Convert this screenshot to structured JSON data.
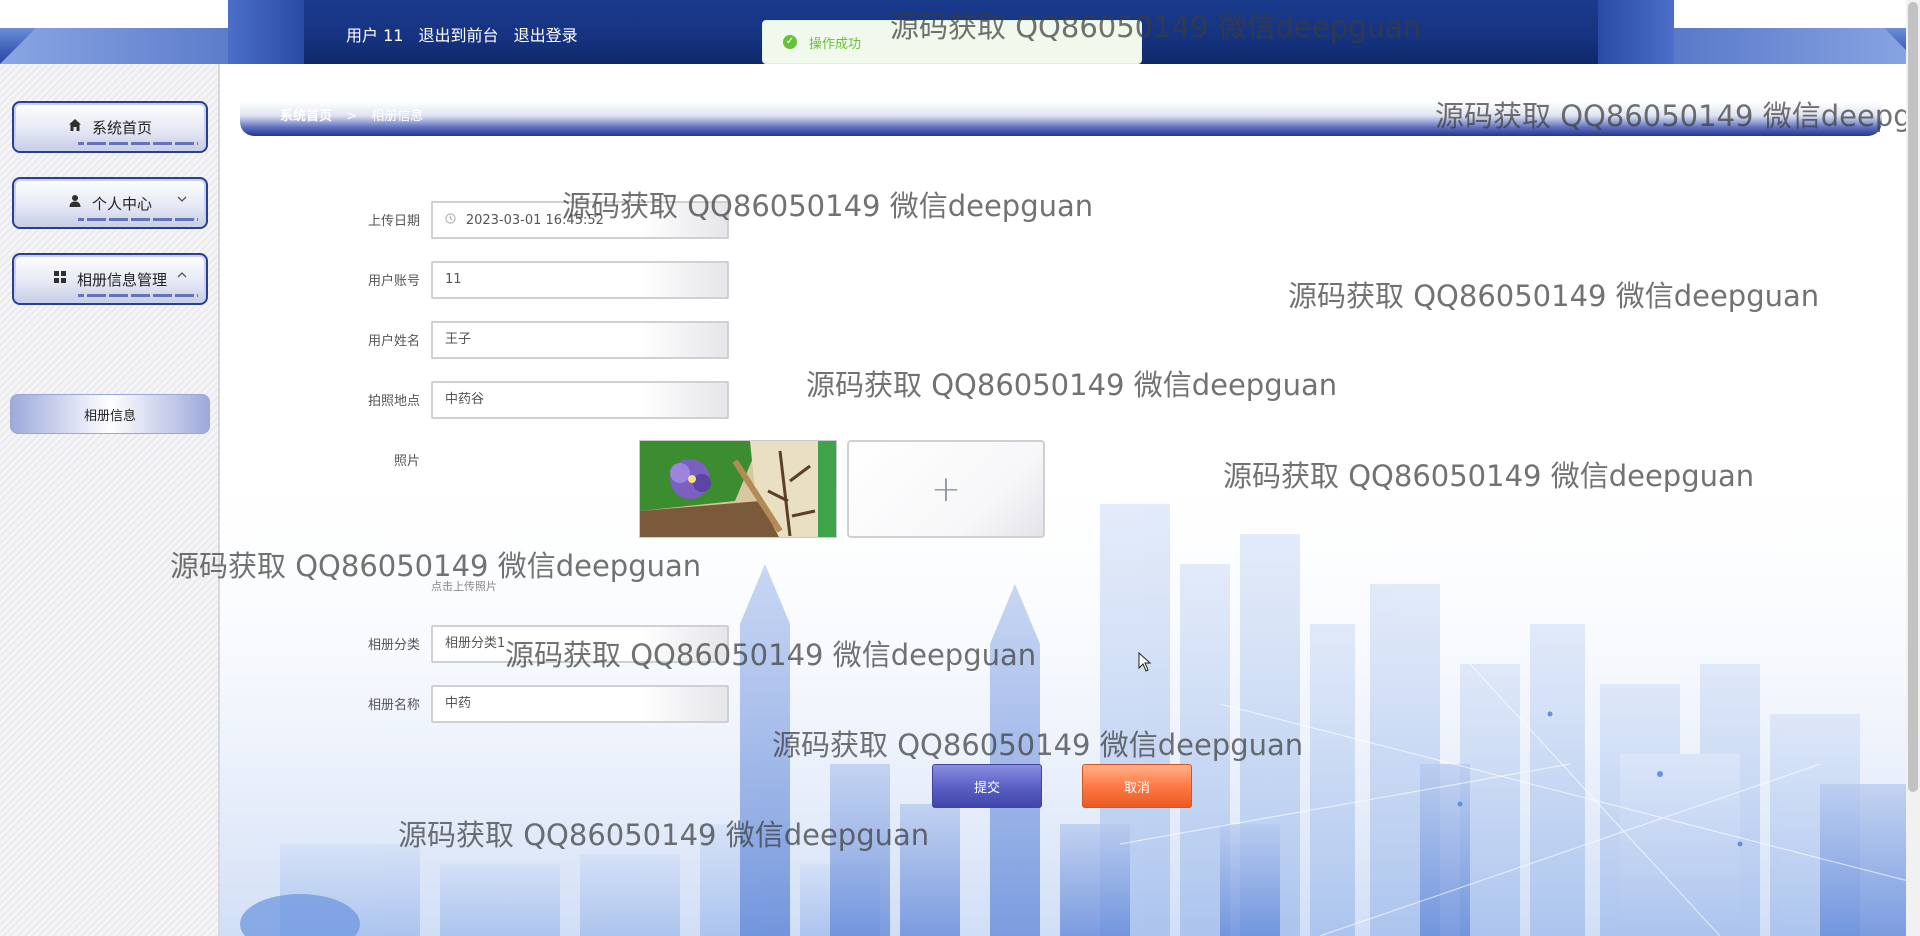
{
  "header": {
    "user_label": "用户 11",
    "back_to_front_label": "退出到前台",
    "logout_label": "退出登录"
  },
  "toast": {
    "message": "操作成功",
    "icon": "check-circle-icon",
    "color": "#67c23a"
  },
  "sidebar": {
    "items": [
      {
        "label": "系统首页",
        "icon": "home-icon"
      },
      {
        "label": "个人中心",
        "icon": "user-icon",
        "chevron": "chevron-down-icon"
      },
      {
        "label": "相册信息管理",
        "icon": "grid-icon",
        "chevron": "chevron-up-icon"
      }
    ],
    "subitems": [
      {
        "label": "相册信息"
      }
    ]
  },
  "breadcrumb": {
    "home": "系统首页",
    "separator": ">",
    "current": "相册信息"
  },
  "form": {
    "upload_date": {
      "label": "上传日期",
      "value": "2023-03-01 16:45:52"
    },
    "account": {
      "label": "用户账号",
      "value": "11"
    },
    "name": {
      "label": "用户姓名",
      "value": "王子"
    },
    "location": {
      "label": "拍照地点",
      "value": "中药谷"
    },
    "photo": {
      "label": "照片",
      "hint": "点击上传照片",
      "uploader_glyph": "+"
    },
    "category": {
      "label": "相册分类",
      "value": "相册分类1"
    },
    "album_name": {
      "label": "相册名称",
      "value": "中药"
    }
  },
  "buttons": {
    "submit": "提交",
    "cancel": "取消"
  },
  "watermark": "源码获取 QQ86050149 微信deepguan",
  "colors": {
    "header_navy": "#163380",
    "submit_purple": "#5d61c7",
    "cancel_orange": "#ff7a46",
    "success_green": "#67c23a"
  }
}
